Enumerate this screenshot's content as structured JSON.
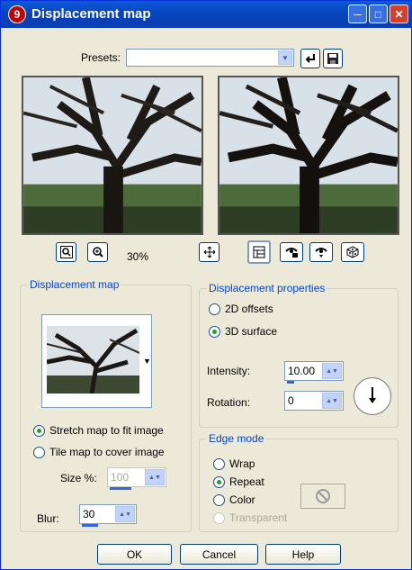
{
  "window": {
    "title": "Displacement map",
    "icon_label": "9"
  },
  "presets": {
    "label": "Presets:",
    "value": ""
  },
  "zoom": {
    "level": "30%"
  },
  "displacement_map": {
    "title": "Displacement map",
    "stretch_label": "Stretch map to fit image",
    "tile_label": "Tile map to cover image",
    "selected_mode": "stretch",
    "size_label": "Size %:",
    "size_value": "100",
    "blur_label": "Blur:",
    "blur_value": "30"
  },
  "displacement_properties": {
    "title": "Displacement properties",
    "offsets_label": "2D offsets",
    "surface_label": "3D surface",
    "selected": "3D surface",
    "intensity_label": "Intensity:",
    "intensity_value": "10.00",
    "rotation_label": "Rotation:",
    "rotation_value": "0"
  },
  "edge_mode": {
    "title": "Edge mode",
    "wrap_label": "Wrap",
    "repeat_label": "Repeat",
    "color_label": "Color",
    "transparent_label": "Transparent",
    "selected": "Repeat"
  },
  "buttons": {
    "ok": "OK",
    "cancel": "Cancel",
    "help": "Help"
  },
  "colors": {
    "titlebar": "#0842bd",
    "group_title": "#0046d5",
    "dialog_bg": "#ece9d8",
    "radio_dot": "#21a121"
  },
  "icons": [
    "zoom-fit-icon",
    "zoom-in-icon",
    "pan-icon",
    "proof-icon",
    "auto-proof-icon",
    "reset-icon",
    "randomize-icon",
    "save-preset-icon",
    "load-preset-icon"
  ]
}
